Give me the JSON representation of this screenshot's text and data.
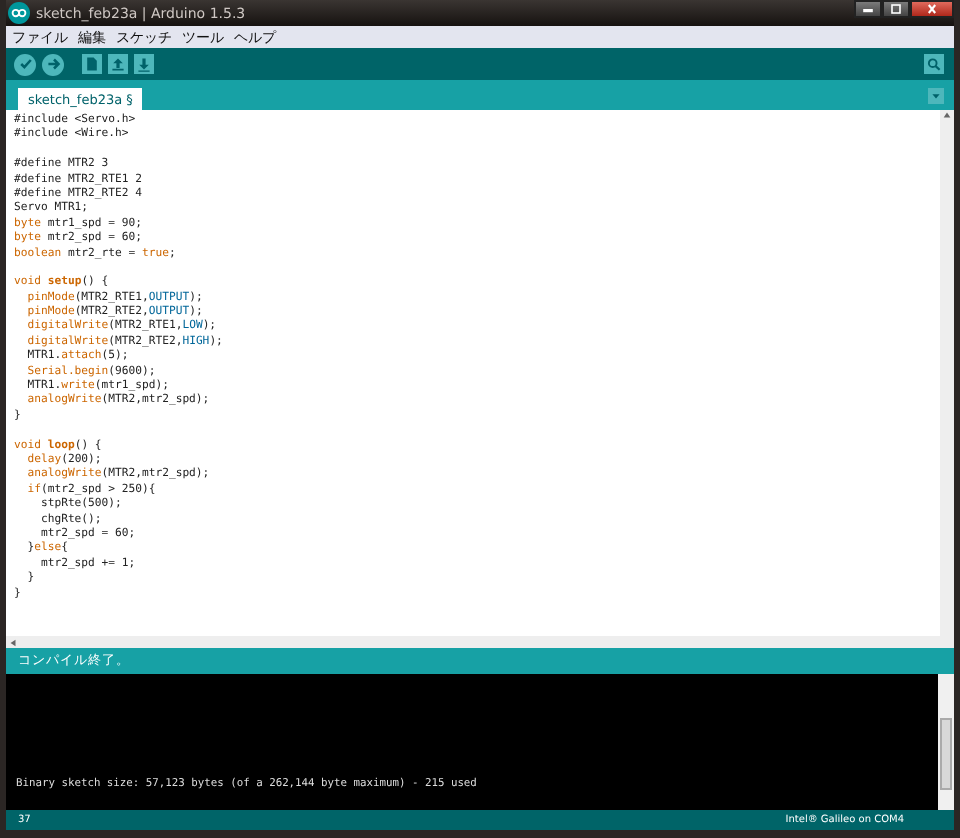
{
  "window": {
    "title": "sketch_feb23a | Arduino 1.5.3"
  },
  "menu": [
    "ファイル",
    "編集",
    "スケッチ",
    "ツール",
    "ヘルプ"
  ],
  "tabs": [
    {
      "label": "sketch_feb23a §",
      "selected": true
    }
  ],
  "editor": {
    "lines": [
      {
        "kind": "code",
        "tokens": [
          {
            "text": "#include <Servo.h>",
            "kind": "plain"
          }
        ]
      },
      {
        "kind": "code",
        "tokens": [
          {
            "text": "#include <Wire.h>",
            "kind": "plain"
          }
        ]
      },
      {
        "kind": "blank"
      },
      {
        "kind": "code",
        "tokens": [
          {
            "text": "#define MTR2 3",
            "kind": "plain"
          }
        ]
      },
      {
        "kind": "code",
        "tokens": [
          {
            "text": "#define MTR2_RTE1 2",
            "kind": "plain"
          }
        ]
      },
      {
        "kind": "code",
        "tokens": [
          {
            "text": "#define MTR2_RTE2 4",
            "kind": "plain"
          }
        ]
      },
      {
        "kind": "code",
        "tokens": [
          {
            "text": "Servo MTR1;",
            "kind": "plain"
          }
        ]
      },
      {
        "kind": "code",
        "tokens": [
          {
            "text": "byte",
            "kind": "keyword"
          },
          {
            "text": " mtr1_spd = 90;",
            "kind": "plain"
          }
        ]
      },
      {
        "kind": "code",
        "tokens": [
          {
            "text": "byte",
            "kind": "keyword"
          },
          {
            "text": " mtr2_spd = 60;",
            "kind": "plain"
          }
        ]
      },
      {
        "kind": "code",
        "tokens": [
          {
            "text": "boolean",
            "kind": "keyword"
          },
          {
            "text": " mtr2_rte = ",
            "kind": "plain"
          },
          {
            "text": "true",
            "kind": "keyword"
          },
          {
            "text": ";",
            "kind": "plain"
          }
        ]
      },
      {
        "kind": "blank"
      },
      {
        "kind": "code",
        "tokens": [
          {
            "text": "void ",
            "kind": "keyword"
          },
          {
            "text": "setup",
            "kind": "function"
          },
          {
            "text": "() {",
            "kind": "plain"
          }
        ]
      },
      {
        "kind": "code",
        "tokens": [
          {
            "text": "  pinMode",
            "kind": "keyword"
          },
          {
            "text": "(MTR2_RTE1,",
            "kind": "plain"
          },
          {
            "text": "OUTPUT",
            "kind": "constant"
          },
          {
            "text": ");",
            "kind": "plain"
          }
        ]
      },
      {
        "kind": "code",
        "tokens": [
          {
            "text": "  pinMode",
            "kind": "keyword"
          },
          {
            "text": "(MTR2_RTE2,",
            "kind": "plain"
          },
          {
            "text": "OUTPUT",
            "kind": "constant"
          },
          {
            "text": ");",
            "kind": "plain"
          }
        ]
      },
      {
        "kind": "code",
        "tokens": [
          {
            "text": "  digitalWrite",
            "kind": "keyword"
          },
          {
            "text": "(MTR2_RTE1,",
            "kind": "plain"
          },
          {
            "text": "LOW",
            "kind": "constant"
          },
          {
            "text": ");",
            "kind": "plain"
          }
        ]
      },
      {
        "kind": "code",
        "tokens": [
          {
            "text": "  digitalWrite",
            "kind": "keyword"
          },
          {
            "text": "(MTR2_RTE2,",
            "kind": "plain"
          },
          {
            "text": "HIGH",
            "kind": "constant"
          },
          {
            "text": ");",
            "kind": "plain"
          }
        ]
      },
      {
        "kind": "code",
        "tokens": [
          {
            "text": "  MTR1.",
            "kind": "plain"
          },
          {
            "text": "attach",
            "kind": "keyword"
          },
          {
            "text": "(5);",
            "kind": "plain"
          }
        ]
      },
      {
        "kind": "code",
        "tokens": [
          {
            "text": "  Serial.begin",
            "kind": "keyword"
          },
          {
            "text": "(9600);",
            "kind": "plain"
          }
        ]
      },
      {
        "kind": "code",
        "tokens": [
          {
            "text": "  MTR1.",
            "kind": "plain"
          },
          {
            "text": "write",
            "kind": "keyword"
          },
          {
            "text": "(mtr1_spd);",
            "kind": "plain"
          }
        ]
      },
      {
        "kind": "code",
        "tokens": [
          {
            "text": "  analogWrite",
            "kind": "keyword"
          },
          {
            "text": "(MTR2,mtr2_spd);",
            "kind": "plain"
          }
        ]
      },
      {
        "kind": "code",
        "tokens": [
          {
            "text": "}",
            "kind": "plain"
          }
        ]
      },
      {
        "kind": "blank"
      },
      {
        "kind": "code",
        "tokens": [
          {
            "text": "void ",
            "kind": "keyword"
          },
          {
            "text": "loop",
            "kind": "function"
          },
          {
            "text": "() {",
            "kind": "plain"
          }
        ]
      },
      {
        "kind": "code",
        "tokens": [
          {
            "text": "  delay",
            "kind": "keyword"
          },
          {
            "text": "(200);",
            "kind": "plain"
          }
        ]
      },
      {
        "kind": "code",
        "tokens": [
          {
            "text": "  analogWrite",
            "kind": "keyword"
          },
          {
            "text": "(MTR2,mtr2_spd);",
            "kind": "plain"
          }
        ]
      },
      {
        "kind": "code",
        "tokens": [
          {
            "text": "  if",
            "kind": "keyword"
          },
          {
            "text": "(mtr2_spd > 250){",
            "kind": "plain"
          }
        ]
      },
      {
        "kind": "code",
        "tokens": [
          {
            "text": "    stpRte(500);",
            "kind": "plain"
          }
        ]
      },
      {
        "kind": "code",
        "tokens": [
          {
            "text": "    chgRte();",
            "kind": "plain"
          }
        ]
      },
      {
        "kind": "code",
        "tokens": [
          {
            "text": "    mtr2_spd = 60;",
            "kind": "plain"
          }
        ]
      },
      {
        "kind": "code",
        "tokens": [
          {
            "text": "  }",
            "kind": "plain"
          },
          {
            "text": "else",
            "kind": "keyword"
          },
          {
            "text": "{",
            "kind": "plain"
          }
        ]
      },
      {
        "kind": "code",
        "tokens": [
          {
            "text": "    mtr2_spd += 1;",
            "kind": "plain"
          }
        ]
      },
      {
        "kind": "code",
        "tokens": [
          {
            "text": "  }",
            "kind": "plain"
          }
        ]
      },
      {
        "kind": "code",
        "tokens": [
          {
            "text": "}",
            "kind": "plain"
          }
        ]
      }
    ]
  },
  "status": "コンパイル終了。",
  "console": [
    "Binary sketch size: 57,123 bytes (of a 262,144 byte maximum) - 215 used"
  ],
  "status_bar": {
    "line": "37",
    "board": "Intel® Galileo on COM4"
  }
}
